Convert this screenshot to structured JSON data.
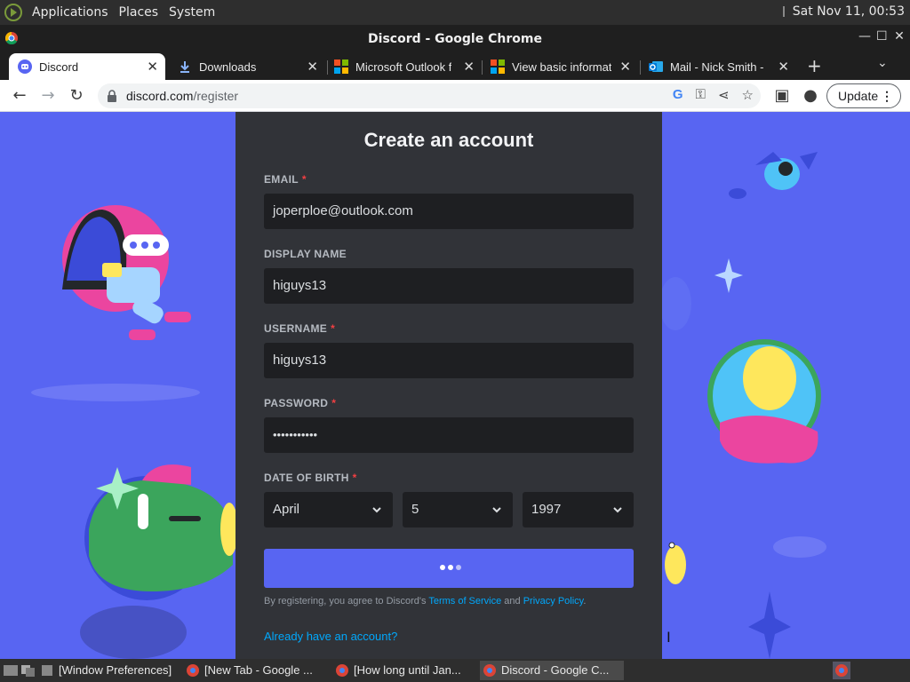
{
  "top_panel": {
    "menus": [
      "Applications",
      "Places",
      "System"
    ],
    "clock": "Sat Nov 11, 00:53"
  },
  "window": {
    "title": "Discord - Google Chrome"
  },
  "tabs": [
    {
      "label": "Discord",
      "icon": "discord-icon",
      "active": true
    },
    {
      "label": "Downloads",
      "icon": "download-icon",
      "active": false
    },
    {
      "label": "Microsoft Outlook f",
      "icon": "microsoft-icon",
      "active": false
    },
    {
      "label": "View basic informat",
      "icon": "microsoft-icon",
      "active": false
    },
    {
      "label": "Mail - Nick Smith -",
      "icon": "outlook-icon",
      "active": false
    }
  ],
  "toolbar": {
    "url_host": "discord.com",
    "url_path": "/register",
    "update_label": "Update"
  },
  "form": {
    "title": "Create an account",
    "email_label": "EMAIL",
    "email_value": "joperploe@outlook.com",
    "display_name_label": "DISPLAY NAME",
    "display_name_value": "higuys13",
    "username_label": "USERNAME",
    "username_value": "higuys13",
    "password_label": "PASSWORD",
    "password_value": "•••••••••••",
    "required_marker": "*",
    "dob_label": "DATE OF BIRTH",
    "dob_month": "April",
    "dob_day": "5",
    "dob_year": "1997",
    "legal_prefix": "By registering, you agree to Discord's ",
    "tos_link": "Terms of Service",
    "legal_and": " and ",
    "privacy_link": "Privacy Policy",
    "legal_suffix": ".",
    "login_link": "Already have an account?"
  },
  "taskbar": [
    {
      "label": "[Window Preferences]",
      "active": false
    },
    {
      "label": "[New Tab - Google ...",
      "active": false
    },
    {
      "label": "[How long until Jan...",
      "active": false
    },
    {
      "label": "Discord - Google C...",
      "active": true
    }
  ],
  "colors": {
    "blurple": "#5865f2",
    "form_bg": "#313338",
    "input_bg": "#1e1f22",
    "link": "#00a8fc",
    "required": "#f23f42"
  }
}
